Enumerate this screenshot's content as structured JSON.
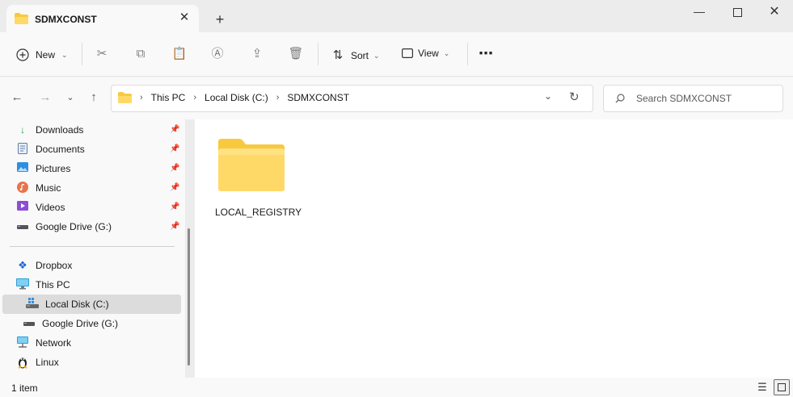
{
  "window": {
    "tab_title": "SDMXCONST",
    "new_tab_symbol": "+",
    "close_symbol": "✕"
  },
  "toolbar": {
    "new_label": "New",
    "sort_label": "Sort",
    "view_label": "View",
    "more_symbol": "⋯"
  },
  "address": {
    "crumbs": [
      "This PC",
      "Local Disk (C:)",
      "SDMXCONST"
    ],
    "search_placeholder": "Search SDMXCONST"
  },
  "sidebar": {
    "quick_access": [
      {
        "label": "Downloads",
        "icon": "download-icon",
        "pinned": true
      },
      {
        "label": "Documents",
        "icon": "documents-icon",
        "pinned": true
      },
      {
        "label": "Pictures",
        "icon": "pictures-icon",
        "pinned": true
      },
      {
        "label": "Music",
        "icon": "music-icon",
        "pinned": true
      },
      {
        "label": "Videos",
        "icon": "videos-icon",
        "pinned": true
      },
      {
        "label": "Google Drive (G:)",
        "icon": "drive-icon",
        "pinned": true
      }
    ],
    "locations": [
      {
        "label": "Dropbox",
        "icon": "dropbox-icon"
      },
      {
        "label": "This PC",
        "icon": "computer-icon"
      },
      {
        "label": "Local Disk (C:)",
        "icon": "disk-icon",
        "selected": true
      },
      {
        "label": "Google Drive (G:)",
        "icon": "drive-icon"
      },
      {
        "label": "Network",
        "icon": "network-icon"
      },
      {
        "label": "Linux",
        "icon": "linux-icon"
      }
    ]
  },
  "content": {
    "items": [
      {
        "name": "LOCAL_REGISTRY",
        "type": "folder"
      }
    ]
  },
  "status": {
    "item_count": "1 item"
  },
  "colors": {
    "folder_yellow": "#f8c93e",
    "folder_light": "#ffd968",
    "selection": "#dcdcdc",
    "accent_blue": "#0078d4"
  }
}
